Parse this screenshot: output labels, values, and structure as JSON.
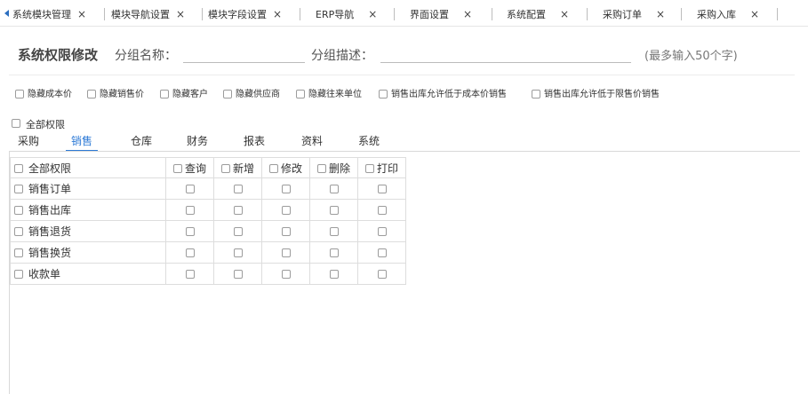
{
  "tabs": [
    {
      "label": "系统模块管理",
      "close": "×"
    },
    {
      "label": "模块导航设置",
      "close": "×"
    },
    {
      "label": "模块字段设置",
      "close": "×"
    },
    {
      "label": "ERP导航",
      "close": "×"
    },
    {
      "label": "界面设置",
      "close": "×"
    },
    {
      "label": "系统配置",
      "close": "×"
    },
    {
      "label": "采购订单",
      "close": "×"
    },
    {
      "label": "采购入库",
      "close": "×"
    }
  ],
  "form": {
    "title": "系统权限修改",
    "group_name_label": "分组名称：",
    "group_name_value": "",
    "group_desc_label": "分组描述：",
    "group_desc_value": "",
    "hint": "(最多输入50个字)"
  },
  "options": [
    "隐藏成本价",
    "隐藏销售价",
    "隐藏客户",
    "隐藏供应商",
    "隐藏往来单位",
    "销售出库允许低于成本价销售",
    "销售出库允许低于限售价销售"
  ],
  "all_permissions_label": "全部权限",
  "subtabs": [
    "采购",
    "销售",
    "仓库",
    "财务",
    "报表",
    "资料",
    "系统"
  ],
  "active_subtab": "销售",
  "grid": {
    "header_all": "全部权限",
    "columns": [
      "查询",
      "新增",
      "修改",
      "删除",
      "打印"
    ],
    "rows": [
      "销售订单",
      "销售出库",
      "销售退货",
      "销售换货",
      "收款单"
    ]
  },
  "colors": {
    "accent": "#2d7ad6",
    "tab_arrow": "#2c6fc0"
  }
}
